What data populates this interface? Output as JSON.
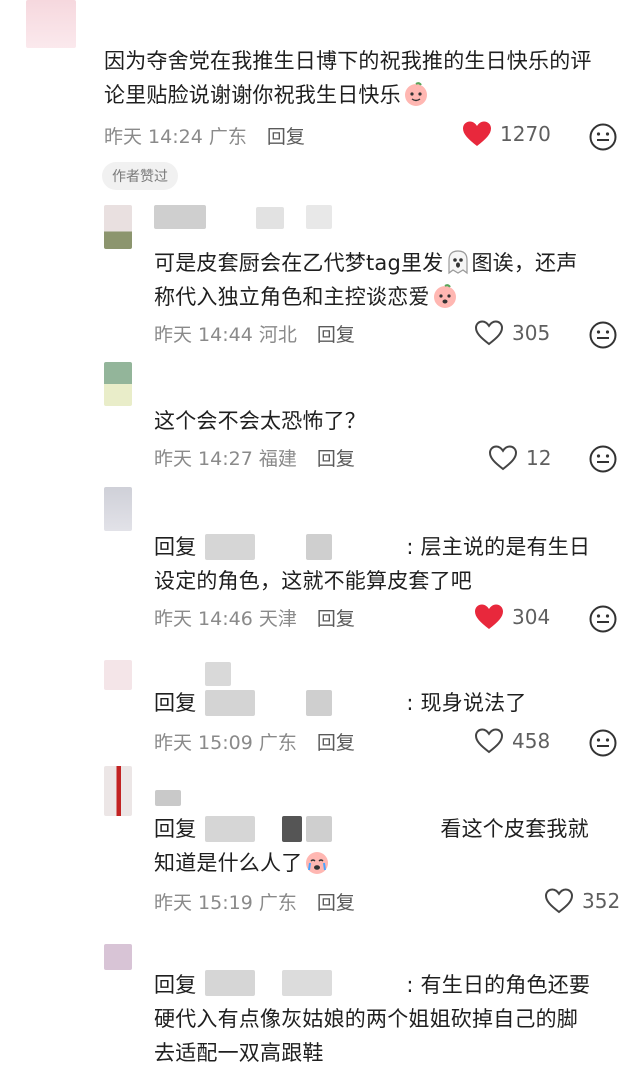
{
  "comments": [
    {
      "text_lines": [
        "因为夺舍党在我推生日博下的祝我推的生日快乐的评",
        "论里贴脸说谢谢你祝我生日快乐"
      ],
      "time": "昨天 14:24",
      "location": "广东",
      "reply_label": "回复",
      "likes": "1270",
      "liked": true,
      "badge": "作者赞过",
      "emoji": "peach-face-emoji"
    },
    {
      "text_lines": [
        "可是皮套厨会在乙代梦tag里发",
        "图诶，还声",
        "称代入独立角色和主控谈恋爱"
      ],
      "time": "昨天 14:44",
      "location": "河北",
      "reply_label": "回复",
      "likes": "305",
      "liked": false,
      "emoji": "ghost-emoji"
    },
    {
      "text_lines": [
        "这个会不会太恐怖了？"
      ],
      "time": "昨天 14:27",
      "location": "福建",
      "reply_label": "回复",
      "likes": "12",
      "liked": false
    },
    {
      "reply_prefix": "回复",
      "text_lines": [
        ": 层主说的是有生日",
        "设定的角色，这就不能算皮套了吧"
      ],
      "time": "昨天 14:46",
      "location": "天津",
      "reply_label": "回复",
      "likes": "304",
      "liked": true
    },
    {
      "reply_prefix": "回复",
      "text_lines": [
        ": 现身说法了"
      ],
      "time": "昨天 15:09",
      "location": "广东",
      "reply_label": "回复",
      "likes": "458",
      "liked": false
    },
    {
      "reply_prefix": "回复",
      "text_lines": [
        "看这个皮套我就",
        "知道是什么人了"
      ],
      "time": "昨天 15:19",
      "location": "广东",
      "reply_label": "回复",
      "likes": "352",
      "liked": false,
      "emoji": "crying-face-emoji"
    },
    {
      "reply_prefix": "回复",
      "text_lines": [
        ": 有生日的角色还要",
        "硬代入有点像灰姑娘的两个姐姐砍掉自己的脚",
        "去适配一双高跟鞋"
      ]
    }
  ],
  "colors": {
    "heart_red": "#e8283c",
    "meta_gray": "#8a8a8a",
    "text": "#1f1f1f"
  }
}
